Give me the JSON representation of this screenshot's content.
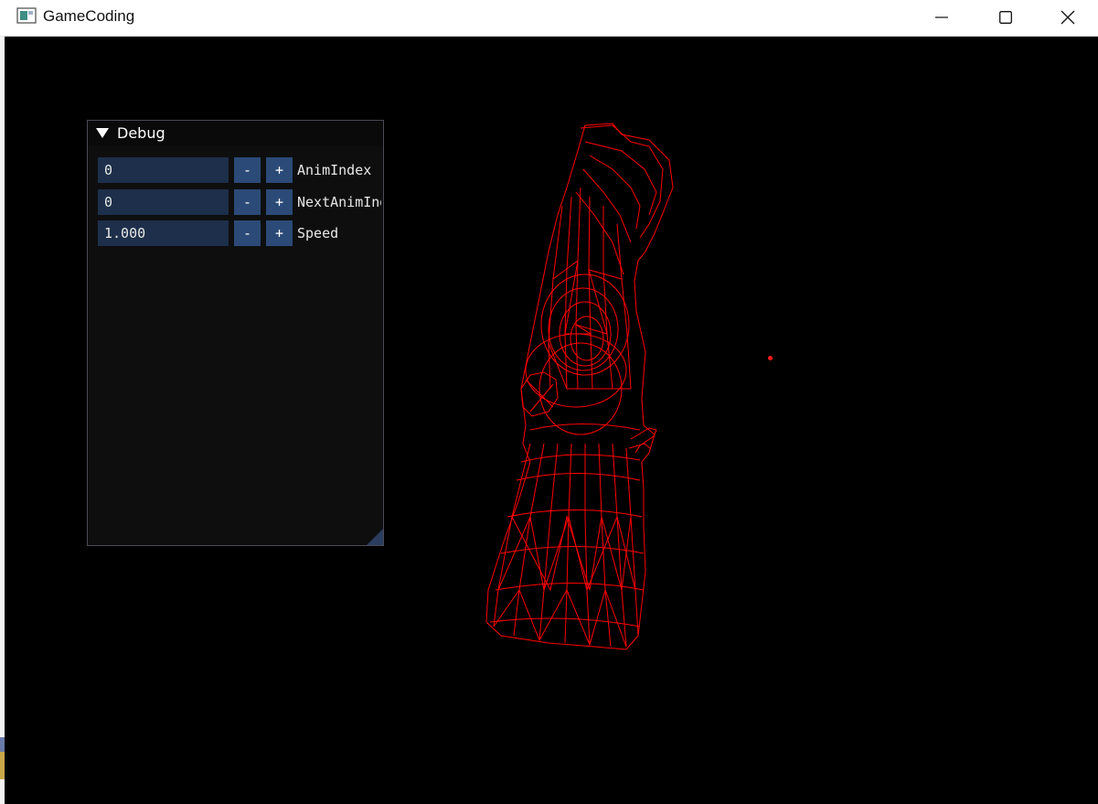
{
  "window": {
    "title": "GameCoding",
    "icon": "app-window-icon",
    "buttons": {
      "minimize": "minimize-icon",
      "maximize": "maximize-icon",
      "close": "close-icon"
    }
  },
  "debug": {
    "title": "Debug",
    "collapse_icon": "triangle-down-icon",
    "rows": [
      {
        "value": "0",
        "minus": "-",
        "plus": "+",
        "label": "AnimIndex"
      },
      {
        "value": "0",
        "minus": "-",
        "plus": "+",
        "label": "NextAnimIndex"
      },
      {
        "value": "1.000",
        "minus": "-",
        "plus": "+",
        "label": "Speed"
      }
    ]
  },
  "scene": {
    "background": "#000000",
    "wireframe_color": "#ff0000"
  }
}
